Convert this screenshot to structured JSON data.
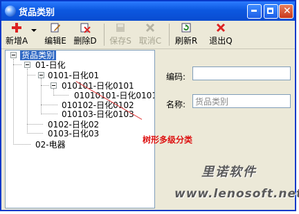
{
  "window": {
    "title": "货品类别"
  },
  "toolbar": {
    "add": "新增A",
    "edit": "编辑E",
    "delete": "删除D",
    "save": "保存S",
    "cancel": "取消C",
    "refresh": "刷新R",
    "exit": "退出Q"
  },
  "tree": {
    "root": "货品类别",
    "n01": "01-日化",
    "n0101": "0101-日化01",
    "n010101": "010101-日化0101",
    "n01010101": "01010101-日化010101",
    "n010102": "010102-日化0102",
    "n010103": "010103-日化0103",
    "n0102": "0102-日化02",
    "n0103": "0103-日化03",
    "n02": "02-电器"
  },
  "annotation": "树形多级分类",
  "form": {
    "code_label": "编码:",
    "code_value": "",
    "name_label": "名称:",
    "name_value": "货品类别"
  },
  "watermark": {
    "line1": "里诺软件",
    "line2": "www.lenosoft.net"
  },
  "colors": {
    "titlebar": "#0c58e0",
    "selection": "#316ac5",
    "annotation": "#d11111"
  }
}
